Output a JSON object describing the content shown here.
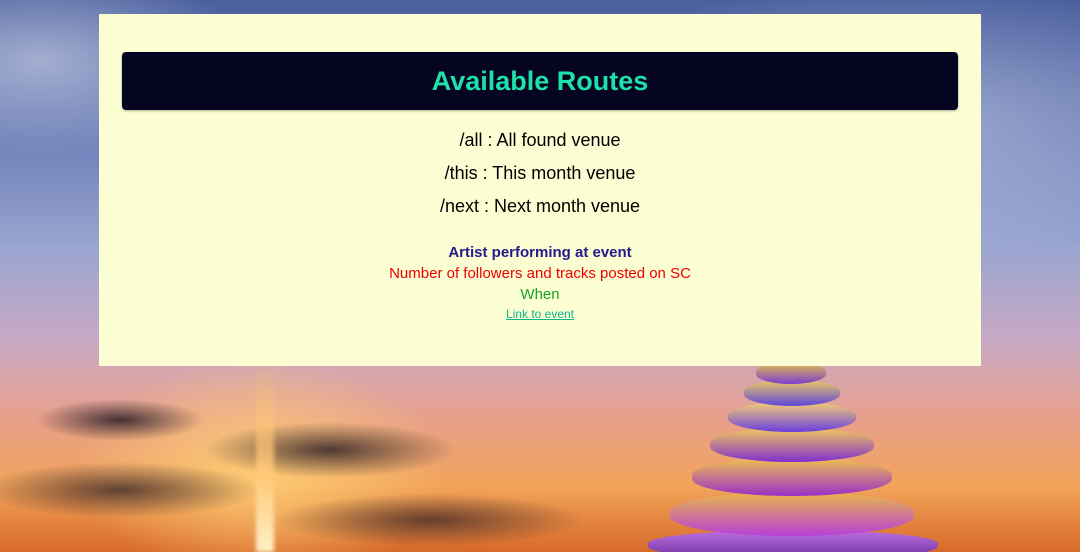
{
  "header": {
    "title": "Available Routes"
  },
  "routes": [
    {
      "text": "/all : All found venue"
    },
    {
      "text": "/this : This month venue"
    },
    {
      "text": "/next : Next month venue"
    }
  ],
  "legend": {
    "artist": "Artist performing at event",
    "followers": "Number of followers and tracks posted on SC",
    "when": "When",
    "link": "Link to event"
  },
  "colors": {
    "panel_bg": "#fbfdd2",
    "banner_bg": "#060521",
    "title": "#1ee0a8",
    "artist": "#251a8c",
    "followers": "#f00000",
    "when": "#14a32a",
    "link": "#12b58a"
  }
}
